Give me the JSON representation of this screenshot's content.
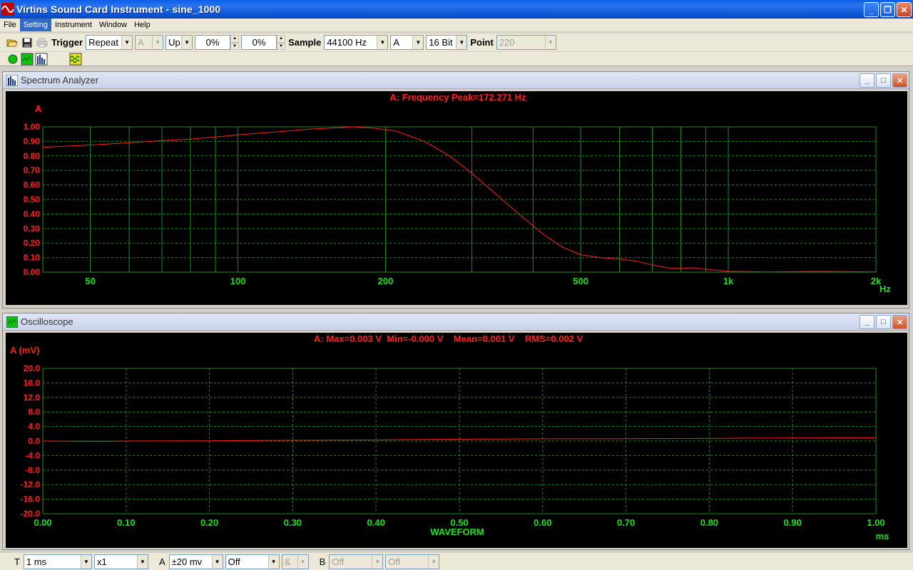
{
  "window": {
    "title": "Virtins Sound Card Instrument - sine_1000"
  },
  "menu": [
    "File",
    "Setting",
    "Instrument",
    "Window",
    "Help"
  ],
  "menu_active": "Setting",
  "toolbar": {
    "trigger_label": "Trigger",
    "trigger_mode": "Repeat",
    "trigger_channel": "A",
    "trigger_edge": "Up",
    "trigger_level": "0%",
    "trigger_delay": "0%",
    "sample_label": "Sample",
    "sample_rate": "44100 Hz",
    "channel": "A",
    "bits": "16 Bit",
    "point_label": "Point",
    "points": "220"
  },
  "spectrum": {
    "title": "Spectrum Analyzer",
    "info": "A: Frequency Peak=172.271 Hz"
  },
  "oscilloscope": {
    "title": "Oscilloscope",
    "info": "A: Max=0.003 V  Min=-0.000 V    Mean=0.001 V    RMS=0.002 V"
  },
  "bottombar": {
    "t_label": "T",
    "timebase": "1 ms",
    "zoom": "x1",
    "a_label": "A",
    "a_range": "±20 mv",
    "a_mode": "Off",
    "combine": "&",
    "b_label": "B",
    "b_range": "Off",
    "b_mode": "Off"
  },
  "colors": {
    "plot_bg": "#000000",
    "grid": "#1f8a1f",
    "trace": "#ff2020",
    "axis_label": "#ff2020",
    "x_tick": "#20e020"
  },
  "chart_data": [
    {
      "type": "line",
      "xscale": "log",
      "x_ticks": [
        "50",
        "100",
        "200",
        "500",
        "1k",
        "2k"
      ],
      "xlabel": "Hz",
      "ylabel": "A",
      "ylim": [
        0,
        1
      ],
      "y_ticks": [
        "1.00",
        "0.90",
        "0.80",
        "0.70",
        "0.60",
        "0.50",
        "0.40",
        "0.30",
        "0.20",
        "0.10",
        "0.00"
      ],
      "grid": true,
      "series": [
        {
          "x": [
            40,
            50,
            60,
            70,
            80,
            90,
            100,
            120,
            140,
            160,
            172,
            190,
            210,
            240,
            270,
            300,
            340,
            380,
            420,
            460,
            500,
            550,
            600,
            650,
            700,
            750,
            800,
            850,
            900,
            1000,
            1200,
            1500,
            1800,
            2000
          ],
          "y": [
            0.86,
            0.875,
            0.89,
            0.905,
            0.915,
            0.93,
            0.945,
            0.965,
            0.985,
            0.993,
            1.0,
            0.99,
            0.97,
            0.9,
            0.8,
            0.68,
            0.52,
            0.38,
            0.26,
            0.17,
            0.12,
            0.1,
            0.09,
            0.075,
            0.05,
            0.03,
            0.025,
            0.03,
            0.02,
            0.005,
            0.002,
            0.005,
            0.003,
            0.002
          ]
        }
      ]
    },
    {
      "type": "line",
      "xlabel": "ms",
      "x_title": "WAVEFORM",
      "ylabel": "A (mV)",
      "xlim": [
        0,
        1
      ],
      "ylim": [
        -20,
        20
      ],
      "x_ticks": [
        "0.00",
        "0.10",
        "0.20",
        "0.30",
        "0.40",
        "0.50",
        "0.60",
        "0.70",
        "0.80",
        "0.90",
        "1.00"
      ],
      "y_ticks": [
        "20.0",
        "16.0",
        "12.0",
        "8.0",
        "4.0",
        "0.0",
        "-4.0",
        "-8.0",
        "-12.0",
        "-16.0",
        "-20.0"
      ],
      "grid": true,
      "series": [
        {
          "x": [
            0,
            0.05,
            0.08,
            0.1,
            0.2,
            0.3,
            0.4,
            0.45,
            0.5,
            0.6,
            0.7,
            0.8,
            0.85,
            0.9,
            1.0
          ],
          "y": [
            0.0,
            -0.1,
            -0.1,
            0.0,
            0.05,
            0.2,
            0.3,
            0.45,
            0.5,
            0.6,
            0.65,
            0.7,
            0.8,
            0.85,
            0.9
          ]
        }
      ]
    }
  ]
}
